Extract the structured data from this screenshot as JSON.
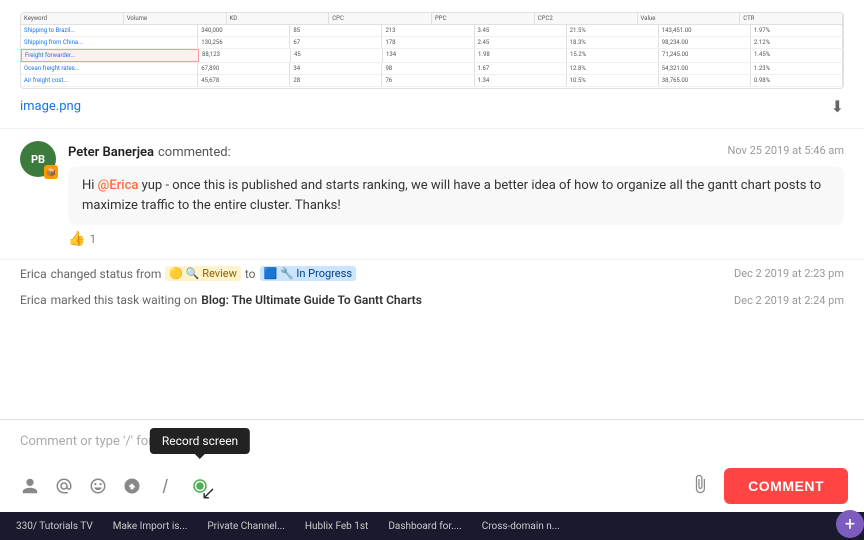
{
  "image": {
    "filename": "image.png",
    "download_label": "⬇"
  },
  "comment": {
    "avatar_initials": "PB",
    "avatar_badge": "📦",
    "commenter_name": "Peter Banerjea",
    "commented_text": "commented:",
    "timestamp": "Nov 25 2019 at 5:46 am",
    "mention": "@Erica",
    "body": " yup - once this is published and starts ranking, we will have a better idea of how to organize all the gantt chart posts to maximize traffic to the entire cluster. Thanks!",
    "likes": "1"
  },
  "status_changes": [
    {
      "actor": "Erica",
      "action": "changed status from",
      "from_icon": "🟡",
      "from_label": "Review",
      "to_word": "to",
      "to_icon": "🔵",
      "to_label": "In Progress",
      "time": "Dec 2 2019 at 2:23 pm"
    },
    {
      "actor": "Erica",
      "action": "marked this task waiting on",
      "task_name": "Blog: The Ultimate Guide To Gantt Charts",
      "time": "Dec 2 2019 at 2:24 pm"
    }
  ],
  "input_area": {
    "placeholder": "Comment or type '/' for commands",
    "comment_button_label": "COMMENT",
    "record_screen_tooltip": "Record screen"
  },
  "toolbar_icons": {
    "person_icon": "👤",
    "at_icon": "@",
    "emoji_smile": "🙂",
    "emoji2": "😊",
    "slash_icon": "/",
    "screen_record_icon": "⏺",
    "attach_icon": "📎"
  },
  "bottom_taskbar": {
    "items": [
      "330/ Tutorials TV",
      "Make Import is...",
      "Private Channel...",
      "Hublix Feb 1st",
      "Dashboard for....",
      "Cross-domain n..."
    ]
  },
  "spreadsheet": {
    "rows": [
      [
        "Shipping to Brazil...",
        "340,000",
        "85",
        "213",
        "3.45",
        "21.5%",
        "143,451.00",
        "1.97%"
      ],
      [
        "Shipping from China...",
        "130,256",
        "67",
        "178",
        "2.45",
        "18.3%",
        "98,234.00",
        "2.12%"
      ],
      [
        "[HIGHLIGHTED] Freight forwarder...",
        "88,123",
        "45",
        "134",
        "1.98",
        "15.2%",
        "71,245.00",
        "1.45%"
      ],
      [
        "Ocean freight rates...",
        "67,890",
        "34",
        "98",
        "1.67",
        "12.8%",
        "54,321.00",
        "1.23%"
      ],
      [
        "Air freight cost...",
        "45,678",
        "28",
        "76",
        "1.34",
        "10.5%",
        "38,765.00",
        "0.98%"
      ]
    ]
  }
}
